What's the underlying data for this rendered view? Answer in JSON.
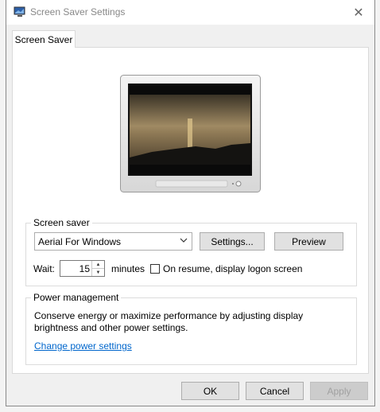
{
  "window": {
    "title": "Screen Saver Settings",
    "close_glyph": "✕"
  },
  "tab": {
    "label": "Screen Saver"
  },
  "screensaver": {
    "group_label": "Screen saver",
    "selected": "Aerial For Windows",
    "settings_button": "Settings...",
    "preview_button": "Preview",
    "wait_label": "Wait:",
    "wait_value": "15",
    "minutes_label": "minutes",
    "resume_label": "On resume, display logon screen"
  },
  "power": {
    "group_label": "Power management",
    "description": "Conserve energy or maximize performance by adjusting display brightness and other power settings.",
    "link": "Change power settings"
  },
  "footer": {
    "ok": "OK",
    "cancel": "Cancel",
    "apply": "Apply"
  }
}
